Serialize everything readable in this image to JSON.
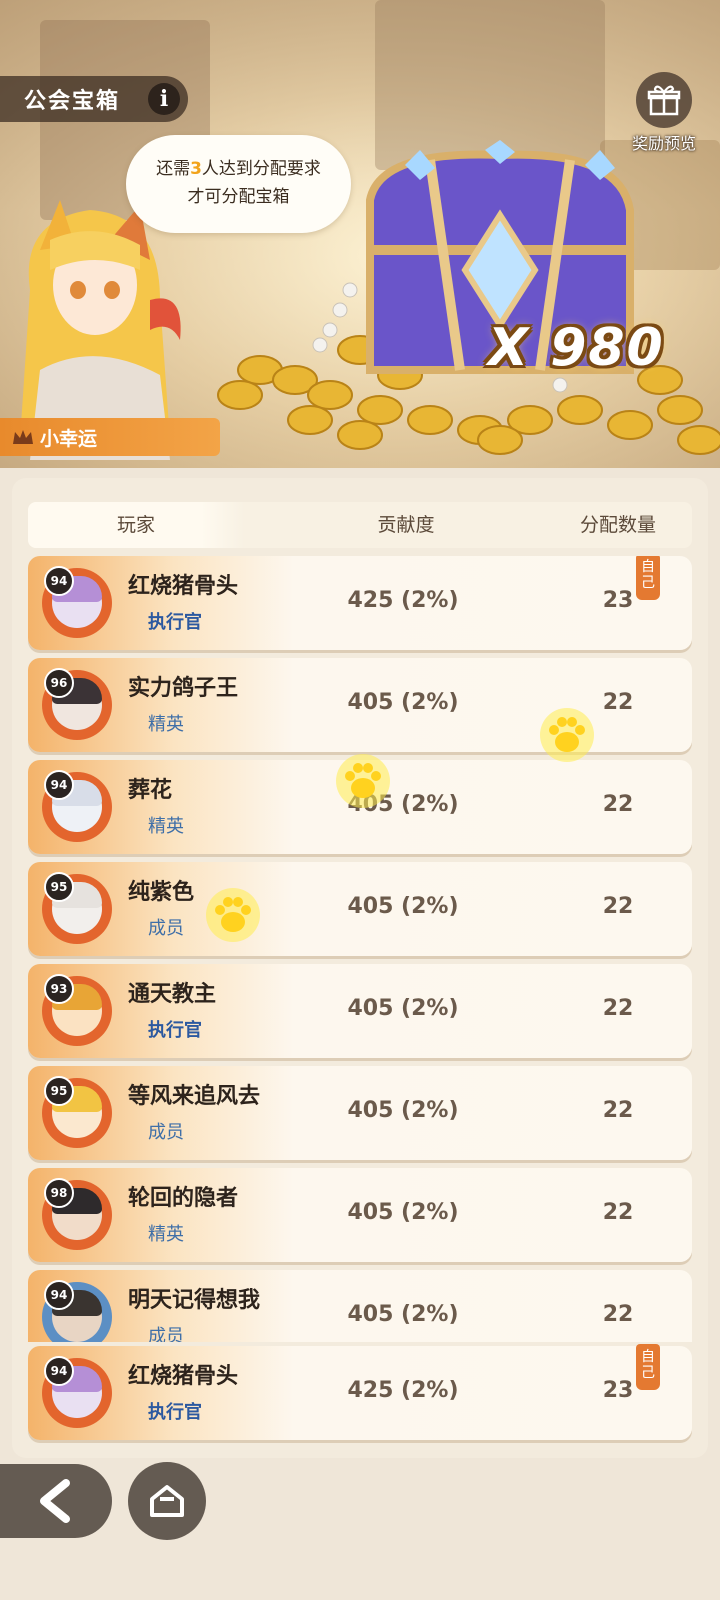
{
  "header": {
    "title": "公会宝箱",
    "info_icon": "info-icon",
    "reward_preview_label": "奖励预览",
    "gift_icon": "gift-icon"
  },
  "bubble": {
    "line1_pre": "还需",
    "line1_num": "3",
    "line1_post": "人达到分配要求",
    "line2": "才可分配宝箱"
  },
  "chest": {
    "count_text": "X 980"
  },
  "character": {
    "name": "小幸运"
  },
  "table": {
    "headers": [
      "玩家",
      "贡献度",
      "分配数量"
    ],
    "rows": [
      {
        "level": "94",
        "name": "红烧猪骨头",
        "rank": "执行官",
        "contribution": "425 (2%)",
        "amount": "23",
        "self_tag": "自己"
      },
      {
        "level": "96",
        "name": "实力鸽子王",
        "rank": "精英",
        "contribution": "405 (2%)",
        "amount": "22"
      },
      {
        "level": "94",
        "name": "葬花",
        "rank": "精英",
        "contribution": "405 (2%)",
        "amount": "22"
      },
      {
        "level": "95",
        "name": "纯紫色",
        "rank": "成员",
        "contribution": "405 (2%)",
        "amount": "22"
      },
      {
        "level": "93",
        "name": "通天教主",
        "rank": "执行官",
        "contribution": "405 (2%)",
        "amount": "22"
      },
      {
        "level": "95",
        "name": "等风来追风去",
        "rank": "成员",
        "contribution": "405 (2%)",
        "amount": "22"
      },
      {
        "level": "98",
        "name": "轮回的隐者",
        "rank": "精英",
        "contribution": "405 (2%)",
        "amount": "22"
      },
      {
        "level": "94",
        "name": "明天记得想我",
        "rank": "成员",
        "contribution": "405 (2%)",
        "amount": "22"
      }
    ],
    "pinned": {
      "level": "94",
      "name": "红烧猪骨头",
      "rank": "执行官",
      "contribution": "425 (2%)",
      "amount": "23",
      "self_tag": "自己"
    }
  },
  "nav": {
    "back_icon": "back-arrow-icon",
    "home_icon": "home-icon"
  },
  "colors": {
    "accent_orange": "#e88a2c",
    "officer_blue": "#2c59a0",
    "member_blue": "#3f6fa8",
    "self_tag": "#e47931"
  }
}
